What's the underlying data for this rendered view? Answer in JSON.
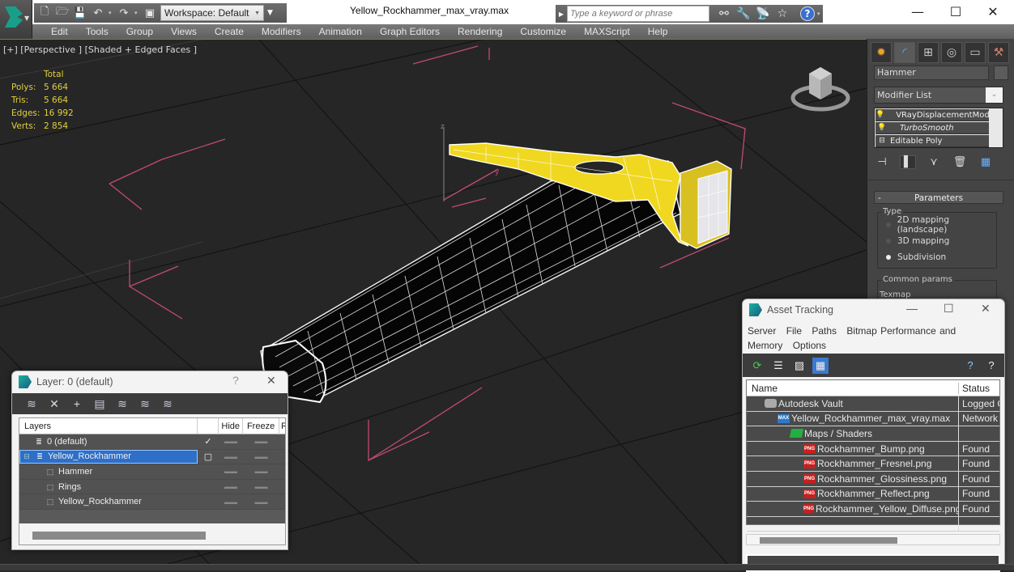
{
  "titlebar": {
    "document_title": "Yellow_Rockhammer_max_vray.max",
    "workspace": "Workspace: Default",
    "search_placeholder": "Type a keyword or phrase",
    "quick_access": [
      "new-icon",
      "open-icon",
      "save-icon",
      "undo-icon",
      "redo-icon",
      "project-icon"
    ],
    "window_controls": {
      "minimize": "—",
      "maximize": "☐",
      "close": "✕"
    }
  },
  "menubar": [
    "Edit",
    "Tools",
    "Group",
    "Views",
    "Create",
    "Modifiers",
    "Animation",
    "Graph Editors",
    "Rendering",
    "Customize",
    "MAXScript",
    "Help"
  ],
  "viewport": {
    "label": "[+] [Perspective ] [Shaded + Edged Faces ]",
    "stats": {
      "header": "Total",
      "rows": [
        {
          "key": "Polys:",
          "value": "5 664"
        },
        {
          "key": "Tris:",
          "value": "5 664"
        },
        {
          "key": "Edges:",
          "value": "16 992"
        },
        {
          "key": "Verts:",
          "value": "2 854"
        }
      ]
    },
    "gizmo_axes": {
      "z": "z",
      "y": "y"
    }
  },
  "command_panel": {
    "tabs": [
      "create",
      "modify",
      "hierarchy",
      "motion",
      "display",
      "utilities"
    ],
    "object_name": "Hammer",
    "modifier_list": "Modifier List",
    "stack": [
      {
        "name": "VRayDisplacementMod",
        "italic": false,
        "icon": "bulb"
      },
      {
        "name": "TurboSmooth",
        "italic": true,
        "icon": "bulb"
      },
      {
        "name": "Editable Poly",
        "italic": false,
        "icon": "box"
      }
    ],
    "rollout": {
      "title": "Parameters",
      "collapse": "-",
      "type_group": "Type",
      "options": [
        {
          "label": "2D mapping (landscape)",
          "selected": false
        },
        {
          "label": "3D mapping",
          "selected": false
        },
        {
          "label": "Subdivision",
          "selected": true
        }
      ],
      "common_group": "Common params",
      "texmap_label": "Texmap"
    }
  },
  "asset_tracking": {
    "title": "Asset Tracking",
    "menu": [
      "Server",
      "File",
      "Paths",
      "Bitmap Performance and Memory",
      "Options"
    ],
    "columns": [
      "Name",
      "Status"
    ],
    "rows": [
      {
        "name": "Autodesk Vault",
        "status": "Logged Out",
        "icon": "vault",
        "indent": 1
      },
      {
        "name": "Yellow_Rockhammer_max_vray.max",
        "status": "Network",
        "icon": "max",
        "indent": 2
      },
      {
        "name": "Maps / Shaders",
        "status": "",
        "icon": "maps",
        "indent": 3
      },
      {
        "name": "Rockhammer_Bump.png",
        "status": "Found",
        "icon": "png",
        "indent": 4
      },
      {
        "name": "Rockhammer_Fresnel.png",
        "status": "Found",
        "icon": "png",
        "indent": 4
      },
      {
        "name": "Rockhammer_Glossiness.png",
        "status": "Found",
        "icon": "png",
        "indent": 4
      },
      {
        "name": "Rockhammer_Reflect.png",
        "status": "Found",
        "icon": "png",
        "indent": 4
      },
      {
        "name": "Rockhammer_Yellow_Diffuse.png",
        "status": "Found",
        "icon": "png",
        "indent": 4
      }
    ]
  },
  "layer_window": {
    "title": "Layer: 0 (default)",
    "help": "?",
    "close": "✕",
    "columns": [
      "Layers",
      "Hide",
      "Freeze",
      "R"
    ],
    "rows": [
      {
        "name": "0 (default)",
        "type": "layer",
        "indent": 1,
        "selected": false,
        "current": true
      },
      {
        "name": "Yellow_Rockhammer",
        "type": "layer",
        "indent": 1,
        "selected": true,
        "current": false
      },
      {
        "name": "Hammer",
        "type": "object",
        "indent": 2,
        "selected": false,
        "current": false
      },
      {
        "name": "Rings",
        "type": "object",
        "indent": 2,
        "selected": false,
        "current": false
      },
      {
        "name": "Yellow_Rockhammer",
        "type": "object",
        "indent": 2,
        "selected": false,
        "current": false
      }
    ]
  },
  "colors": {
    "accent": "#2f6fc8",
    "stats_text": "#e0d040",
    "selection_yellow": "#f0d820",
    "gizmo_pink": "#d04a78",
    "png_icon": "#c62020"
  }
}
